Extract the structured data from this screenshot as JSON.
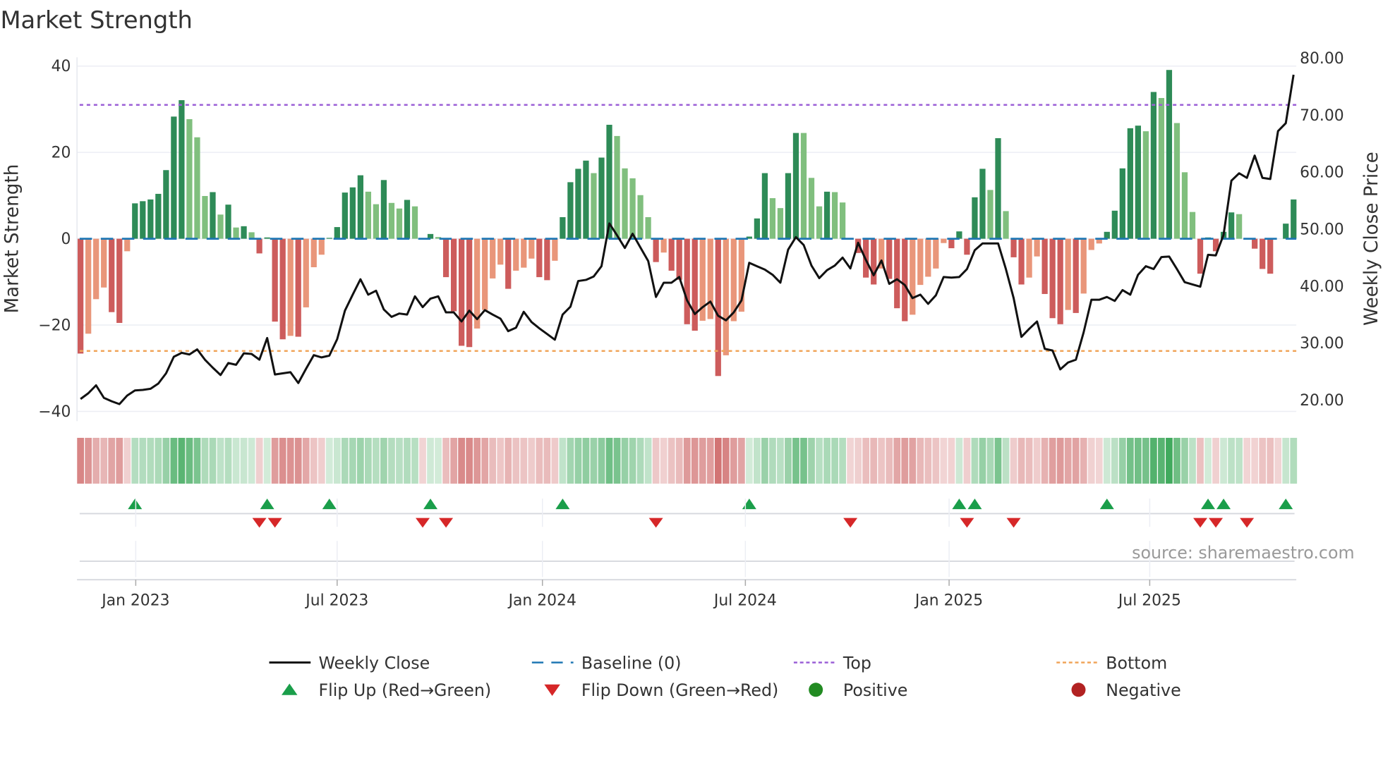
{
  "chart_data": {
    "type": "bar",
    "title": "Market Strength",
    "ylabel": "Market Strength",
    "y2label": "Weekly Close Price",
    "ylim": [
      -42,
      42
    ],
    "y2lim": [
      18.6,
      81.4
    ],
    "yticks": [
      "40",
      "20",
      "0",
      "−20",
      "−40"
    ],
    "ytick_values": [
      40,
      20,
      0,
      -20,
      -40
    ],
    "y2ticks": [
      "80.00",
      "70.00",
      "60.00",
      "50.00",
      "40.00",
      "30.00",
      "20.00"
    ],
    "y2tick_values": [
      80,
      70,
      60,
      50,
      40,
      30,
      20
    ],
    "x_unit": "week index",
    "x_ticks": [
      {
        "label": "Jan 2023",
        "week": 7.1
      },
      {
        "label": "Jul 2023",
        "week": 33.0
      },
      {
        "label": "Jan 2024",
        "week": 59.4
      },
      {
        "label": "Jul 2024",
        "week": 85.5
      },
      {
        "label": "Jan 2025",
        "week": 111.7
      },
      {
        "label": "Jul 2025",
        "week": 137.5
      }
    ],
    "top_level": 31,
    "bottom_level": -26,
    "baseline": 0,
    "strength": [
      -26.6,
      -22,
      -14,
      -11.3,
      -17,
      -19.5,
      -2.9,
      8.2,
      8.7,
      9.1,
      10.4,
      15.9,
      28.3,
      32.1,
      27.7,
      23.5,
      9.9,
      10.8,
      5.6,
      7.9,
      2.6,
      2.9,
      1.5,
      -3.4,
      0.3,
      -19.2,
      -23.3,
      -22.5,
      -22.7,
      -15.9,
      -6.6,
      -3.7,
      0.2,
      2.7,
      10.7,
      11.9,
      14.7,
      10.9,
      8.0,
      13.6,
      8.3,
      7.0,
      9.0,
      7.5,
      0,
      1.1,
      0.4,
      -8.9,
      -16.8,
      -24.8,
      -25.1,
      -20.8,
      -16.5,
      -9.2,
      -6.0,
      -11.6,
      -7.4,
      -6.7,
      -4.6,
      -8.9,
      -9.6,
      -5.1,
      5.0,
      13.1,
      16.2,
      18.1,
      15.2,
      18.8,
      26.4,
      23.8,
      16.3,
      14.0,
      10.1,
      5.0,
      -5.4,
      -3.2,
      -7.4,
      -9.5,
      -19.8,
      -21.3,
      -19.0,
      -18.6,
      -31.8,
      -27.0,
      -19.1,
      -16.9,
      0.5,
      4.7,
      15.2,
      9.4,
      7.1,
      15.2,
      24.5,
      24.5,
      14.1,
      7.5,
      10.9,
      10.8,
      8.4,
      0,
      -3.3,
      -9.0,
      -10.6,
      -6.9,
      -9.3,
      -16.1,
      -19.1,
      -17.6,
      -10.7,
      -8.8,
      -6.9,
      -1.0,
      -2.2,
      1.7,
      -3.7,
      9.6,
      16.2,
      11.3,
      23.3,
      6.4,
      -4.3,
      -10.6,
      -9.0,
      -4.1,
      -12.8,
      -18.4,
      -19.8,
      -16.5,
      -17.2,
      -12.7,
      -2.6,
      -1.1,
      1.6,
      6.5,
      16.3,
      25.6,
      26.2,
      24.9,
      34.0,
      32.6,
      39.1,
      26.8,
      15.4,
      6.2,
      -8.1,
      0.3,
      -2.9,
      1.6,
      6.1,
      5.7,
      0,
      -2.3,
      -7.0,
      -8.1,
      0,
      3.5,
      9.1
    ],
    "weekly_close": [
      20.2,
      21.2,
      22.6,
      20.4,
      19.8,
      19.3,
      20.8,
      21.7,
      21.8,
      22.0,
      22.9,
      24.7,
      27.6,
      28.3,
      28.0,
      28.9,
      27.1,
      25.7,
      24.4,
      26.5,
      26.2,
      28.2,
      28.1,
      27.1,
      30.9,
      24.5,
      24.7,
      24.9,
      23.0,
      25.5,
      27.9,
      27.5,
      27.8,
      30.7,
      35.7,
      38.5,
      41.2,
      38.5,
      39.2,
      35.9,
      34.6,
      35.2,
      35.0,
      38.2,
      36.3,
      37.8,
      38.2,
      35.4,
      35.4,
      33.8,
      35.7,
      34.2,
      35.8,
      35.0,
      34.3,
      32.1,
      32.7,
      35.5,
      33.7,
      32.6,
      31.6,
      30.6,
      35.0,
      36.4,
      40.9,
      41.1,
      41.7,
      43.5,
      51.0,
      48.9,
      46.7,
      49.2,
      46.8,
      44.4,
      38.1,
      40.6,
      40.6,
      41.6,
      37.5,
      35.1,
      36.3,
      37.3,
      34.8,
      34.0,
      35.4,
      37.5,
      44.1,
      43.5,
      42.9,
      42.0,
      40.6,
      46.4,
      48.6,
      47.2,
      43.6,
      41.4,
      42.8,
      43.6,
      45.0,
      43.1,
      47.6,
      44.6,
      41.9,
      44.5,
      40.4,
      41.2,
      40.2,
      37.9,
      38.5,
      36.9,
      38.4,
      41.6,
      41.5,
      41.6,
      43.0,
      46.3,
      47.5,
      47.5,
      47.5,
      43.0,
      37.9,
      31.1,
      32.5,
      33.8,
      29.0,
      28.7,
      25.4,
      26.6,
      27.1,
      31.9,
      37.6,
      37.6,
      38.1,
      37.4,
      39.3,
      38.5,
      42.0,
      43.5,
      43.0,
      45.1,
      45.2,
      43.0,
      40.7,
      40.3,
      39.9,
      45.5,
      45.4,
      49.0,
      58.5,
      59.8,
      59.0,
      62.9,
      59.0,
      58.8,
      67.2,
      68.6,
      77.1
    ],
    "colors": {
      "rising_positive": "#2e8b57",
      "falling_positive": "#80bf7e",
      "falling_negative": "#cd5c5c",
      "rising_negative": "#e9967a",
      "line": "#111111",
      "baseline": "#1f77b4",
      "top": "#9b5fd6",
      "bottom": "#f0a55a",
      "flip_up": "#1a9e4a",
      "flip_down": "#d62728",
      "positive": "#228b22",
      "negative": "#b22222"
    },
    "legend": [
      {
        "label": "Weekly Close",
        "kind": "line"
      },
      {
        "label": "Baseline (0)",
        "kind": "dash"
      },
      {
        "label": "Top",
        "kind": "dot-purple"
      },
      {
        "label": "Bottom",
        "kind": "dot-orange"
      },
      {
        "label": "Flip Up (Red→Green)",
        "kind": "tri-up"
      },
      {
        "label": "Flip Down (Green→Red)",
        "kind": "tri-down"
      },
      {
        "label": "Positive",
        "kind": "dot-green"
      },
      {
        "label": "Negative",
        "kind": "dot-red"
      }
    ],
    "legend_position": "bottom",
    "grid": true,
    "source": "source: sharemaestro.com"
  }
}
